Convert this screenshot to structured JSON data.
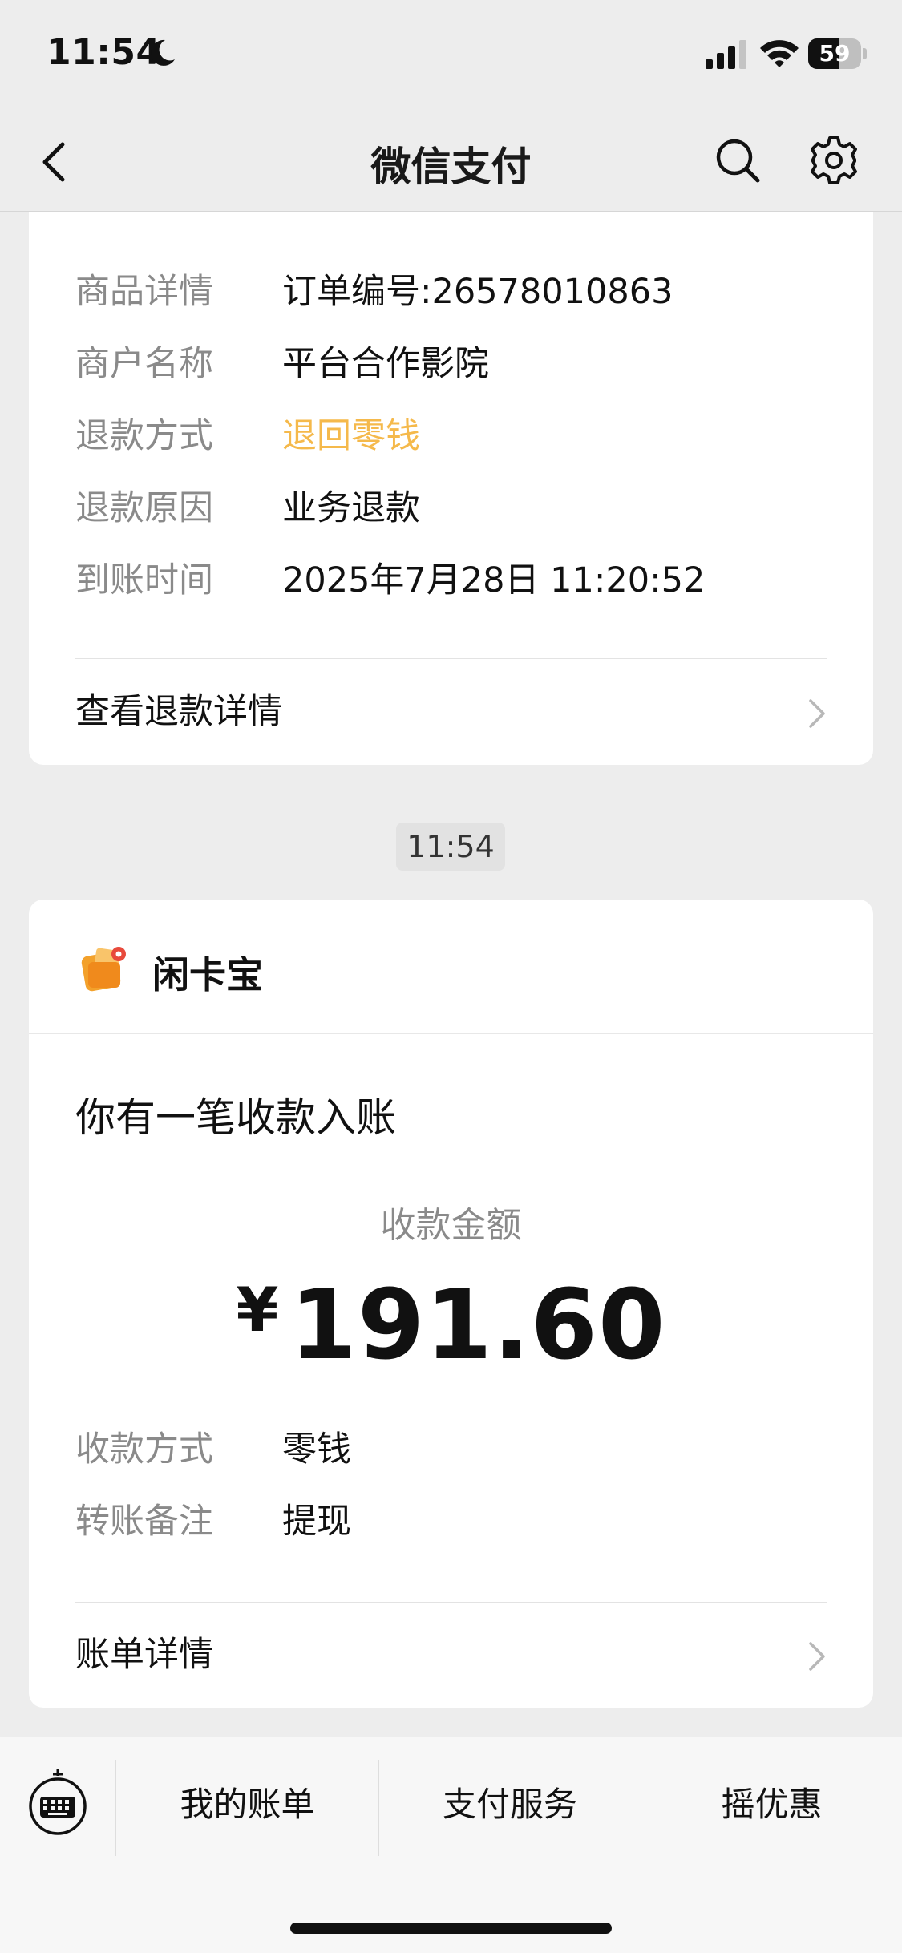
{
  "status_bar": {
    "time": "11:54",
    "battery": "59",
    "battery_level": 0.59
  },
  "nav": {
    "title": "微信支付"
  },
  "refund_card": {
    "rows": [
      {
        "label": "商品详情",
        "value": "订单编号:26578010863"
      },
      {
        "label": "商户名称",
        "value": "平台合作影院"
      },
      {
        "label": "退款方式",
        "value": "退回零钱"
      },
      {
        "label": "退款原因",
        "value": "业务退款"
      },
      {
        "label": "到账时间",
        "value": "2025年7月28日 11:20:52"
      }
    ],
    "link": "查看退款详情"
  },
  "timestamp": "11:54",
  "income_card": {
    "merchant": "闲卡宝",
    "title": "你有一笔收款入账",
    "amount_label": "收款金额",
    "currency": "¥",
    "amount": "191.60",
    "rows": [
      {
        "label": "收款方式",
        "value": "零钱"
      },
      {
        "label": "转账备注",
        "value": "提现"
      }
    ],
    "link": "账单详情"
  },
  "bottom_bar": {
    "tabs": [
      "我的账单",
      "支付服务",
      "摇优惠"
    ]
  },
  "colors": {
    "accent_orange": "#f5b94b",
    "background": "#ededed",
    "card": "#ffffff"
  }
}
